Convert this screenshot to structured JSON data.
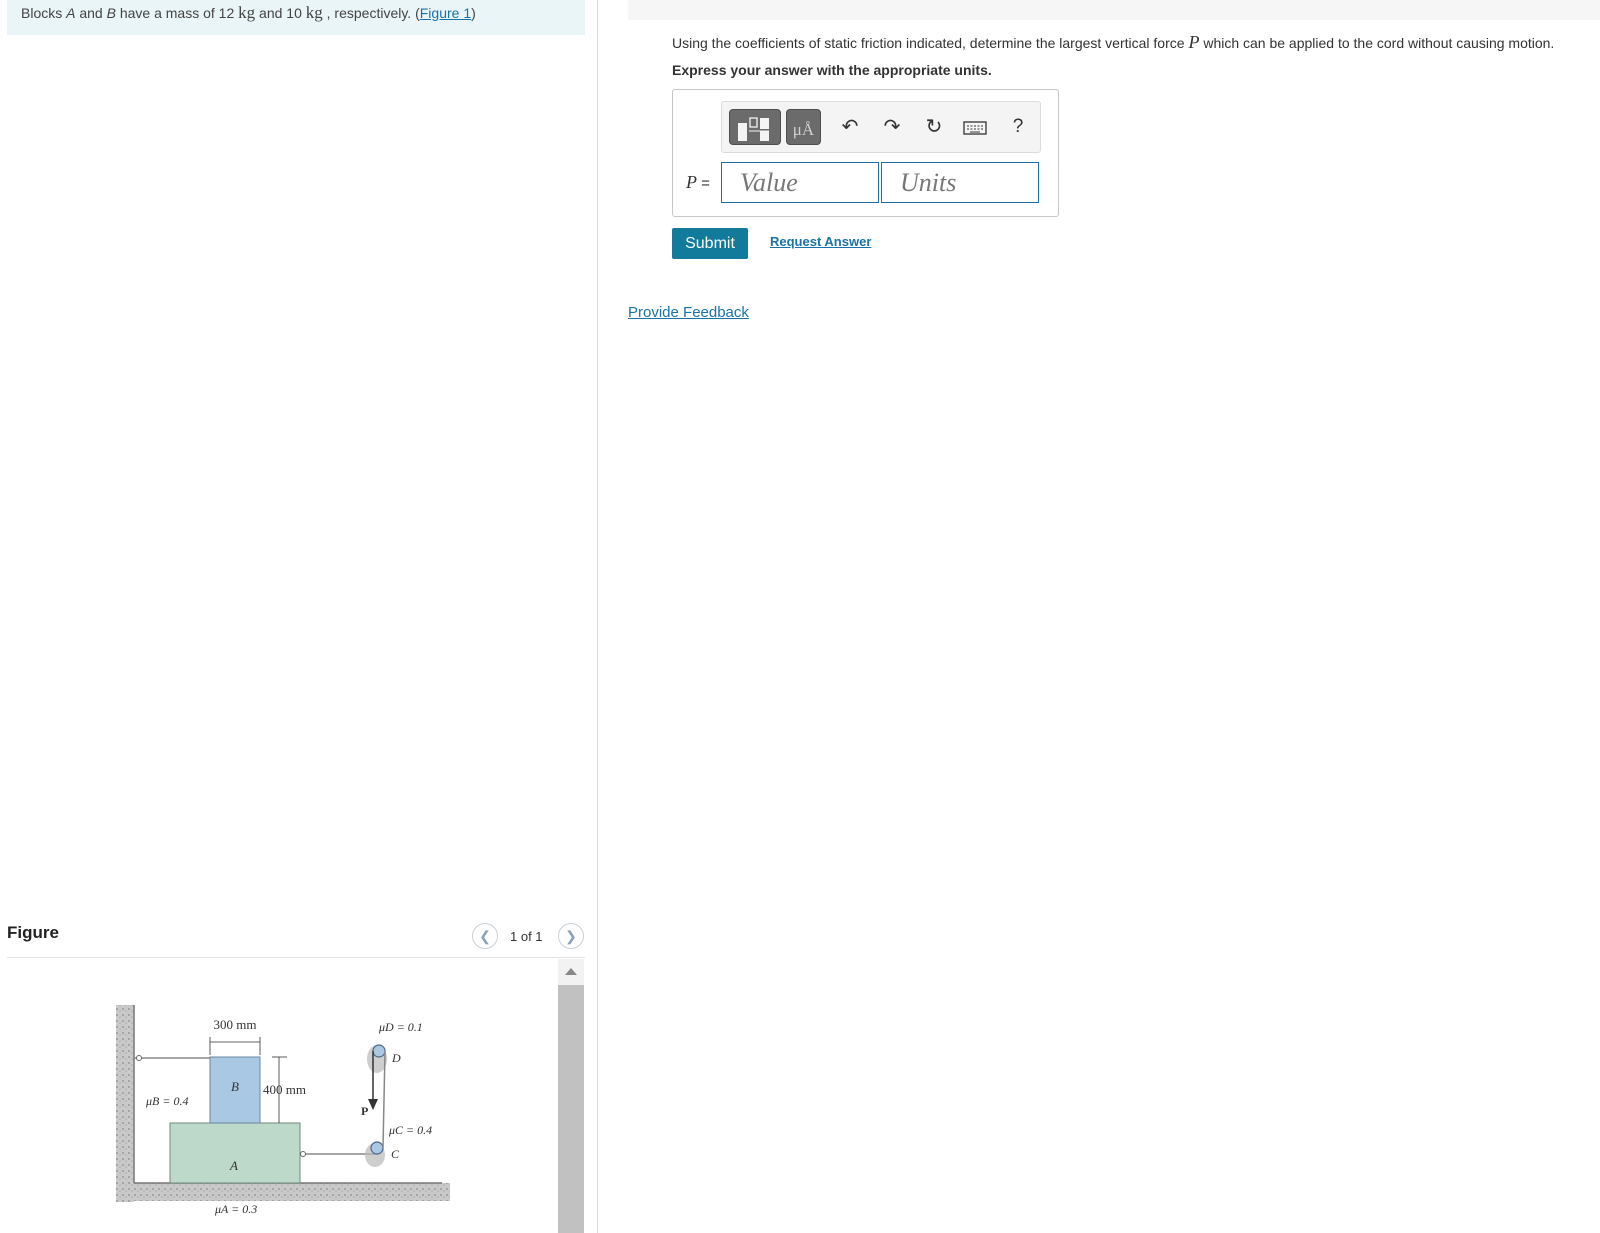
{
  "problem": {
    "text_1": "Blocks ",
    "block_a": "A",
    "text_2": " and ",
    "block_b": "B",
    "text_3": " have a mass of 12 ",
    "unit_1": "kg",
    "text_4": " and 10 ",
    "unit_2": "kg",
    "text_5": " , respectively. (",
    "figure_link": "Figure 1",
    "text_6": ")"
  },
  "figure_panel": {
    "title": "Figure",
    "page_indicator": "1 of 1",
    "prev_icon": "chevron-left-icon",
    "next_icon": "chevron-right-icon"
  },
  "figure_labels": {
    "dim_width": "300 mm",
    "dim_height": "400 mm",
    "mu_b": "μB = 0.4",
    "mu_a": "μA = 0.3",
    "mu_d": "μD = 0.1",
    "mu_c": "μC = 0.4",
    "label_a": "A",
    "label_b": "B",
    "label_c": "C",
    "label_d": "D",
    "label_p": "P"
  },
  "question": {
    "text_1": "Using the coefficients of static friction indicated, determine the largest vertical force ",
    "var": "P",
    "text_2": " which can be applied to the cord without causing motion.",
    "instruction": "Express your answer with the appropriate units."
  },
  "answer": {
    "label_var": "P",
    "label_eq": " =",
    "value_placeholder": "Value",
    "units_placeholder": "Units",
    "toolbar": {
      "templates_icon": "templates-icon",
      "units_label": "μÅ",
      "undo_icon": "undo-icon",
      "redo_icon": "redo-icon",
      "reset_icon": "reset-icon",
      "keyboard_icon": "keyboard-icon",
      "help_label": "?"
    }
  },
  "actions": {
    "submit": "Submit",
    "request_answer": "Request Answer",
    "provide_feedback": "Provide Feedback"
  },
  "colors": {
    "accent": "#127a9a",
    "link": "#1a73a8",
    "intro_bg": "#e9f5f6",
    "block_a": "#bcd9c9",
    "block_b": "#a9c8e4"
  }
}
